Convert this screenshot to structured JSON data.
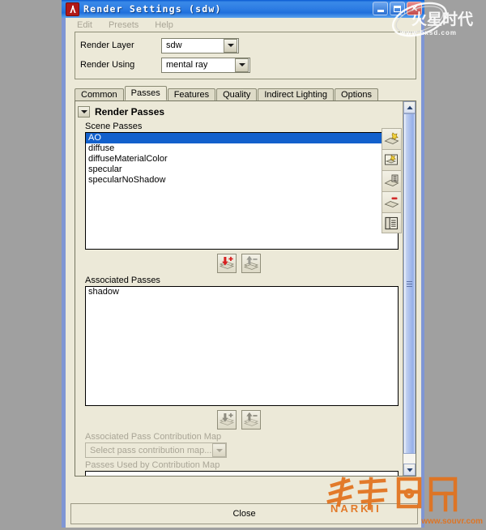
{
  "window": {
    "title": "Render Settings (sdw)",
    "app_icon": "maya-render-settings-icon",
    "buttons": {
      "minimize": "minimize-icon",
      "maximize": "maximize-icon",
      "close": "close-icon"
    }
  },
  "menubar": {
    "items": [
      {
        "label": "Edit"
      },
      {
        "label": "Presets"
      },
      {
        "label": "Help"
      }
    ]
  },
  "fields": {
    "render_layer": {
      "label": "Render Layer",
      "value": "sdw"
    },
    "render_using": {
      "label": "Render Using",
      "value": "mental ray"
    }
  },
  "tabs": [
    {
      "label": "Common",
      "active": false
    },
    {
      "label": "Passes",
      "active": true
    },
    {
      "label": "Features",
      "active": false
    },
    {
      "label": "Quality",
      "active": false
    },
    {
      "label": "Indirect Lighting",
      "active": false
    },
    {
      "label": "Options",
      "active": false
    }
  ],
  "frame": {
    "title": "Render Passes",
    "toggle_icon": "chevron-down-icon"
  },
  "scene_passes": {
    "label": "Scene Passes",
    "items": [
      {
        "name": "AO",
        "selected": true
      },
      {
        "name": "diffuse",
        "selected": false
      },
      {
        "name": "diffuseMaterialColor",
        "selected": false
      },
      {
        "name": "specular",
        "selected": false
      },
      {
        "name": "specularNoShadow",
        "selected": false
      }
    ]
  },
  "scene_pass_buttons": [
    {
      "name": "add-pass-to-layer-button",
      "icon": "down-arrow-plus-icon",
      "enabled": true
    },
    {
      "name": "remove-pass-from-layer-button",
      "icon": "up-arrow-minus-icon",
      "enabled": false
    }
  ],
  "right_toolbar": [
    {
      "name": "create-new-render-pass-button",
      "icon": "pass-new-icon"
    },
    {
      "name": "create-pass-contribution-map-button",
      "icon": "pass-contribution-map-icon"
    },
    {
      "name": "duplicate-render-pass-button",
      "icon": "pass-duplicate-icon"
    },
    {
      "name": "delete-render-pass-button",
      "icon": "pass-delete-icon"
    },
    {
      "name": "pass-attributes-button",
      "icon": "pass-attributes-icon"
    }
  ],
  "associated_passes": {
    "label": "Associated Passes",
    "items": [
      {
        "name": "shadow",
        "selected": false
      }
    ]
  },
  "associated_pass_buttons": [
    {
      "name": "associate-pass-button",
      "icon": "down-arrow-plus-icon",
      "enabled": false
    },
    {
      "name": "disassociate-pass-button",
      "icon": "up-arrow-minus-icon",
      "enabled": false
    }
  ],
  "contribution_map": {
    "label": "Associated Pass Contribution Map",
    "placeholder": "Select pass contribution map...",
    "value": "Select pass contribution map...",
    "used_by_label": "Passes Used by Contribution Map"
  },
  "footer": {
    "close_label": "Close"
  },
  "watermarks": {
    "top": {
      "text": "www.hxsd.com"
    },
    "bottom": {
      "text": "www.souvr.com",
      "brand": "NARKII"
    }
  },
  "colors": {
    "selection_blue": "#1260cc",
    "title_blue": "#2f7ee4",
    "window_border": "#7f96d4",
    "panel_bg": "#ece9d8",
    "desktop_gray": "#a0a0a0",
    "watermark_orange": "#e2721d"
  },
  "scrollbar": {
    "up_icon": "chevron-up-icon",
    "down_icon": "chevron-down-icon"
  }
}
